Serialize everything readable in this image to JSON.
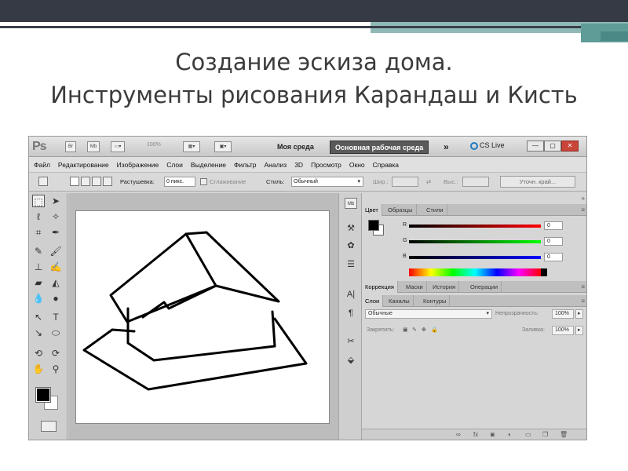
{
  "slide": {
    "title_line1": "Создание эскиза дома.",
    "title_line2": "Инструменты рисования Карандаш и Кисть"
  },
  "app": {
    "logo": "Ps",
    "appbar": {
      "zoom": "100%",
      "workspace_a": "Моя среда",
      "workspace_b": "Основная рабочая среда",
      "more": "»",
      "cslive": "CS Live"
    },
    "menu": [
      "Файл",
      "Редактирование",
      "Изображение",
      "Слои",
      "Выделение",
      "Фильтр",
      "Анализ",
      "3D",
      "Просмотр",
      "Окно",
      "Справка"
    ],
    "options": {
      "feather_label": "Растушевка:",
      "feather_value": "0 пикс.",
      "antialias_label": "Сглаживание",
      "style_label": "Стиль:",
      "style_value": "Обычный",
      "width_label": "Шир.:",
      "height_label": "Выс.:",
      "refine_edge": "Уточн. край..."
    },
    "color_panel": {
      "tabs": [
        "Цвет",
        "Образцы",
        "Стили"
      ],
      "channels": [
        {
          "label": "R",
          "value": "0",
          "color_from": "#000000",
          "color_to": "#ff0000"
        },
        {
          "label": "G",
          "value": "0",
          "color_from": "#000000",
          "color_to": "#00ff00"
        },
        {
          "label": "B",
          "value": "0",
          "color_from": "#000000",
          "color_to": "#0000ff"
        }
      ]
    },
    "adjust_panel": {
      "tabs": [
        "Коррекция",
        "Маски",
        "История",
        "Операции"
      ]
    },
    "layers_panel": {
      "tabs": [
        "Слои",
        "Каналы",
        "Контуры"
      ],
      "blend_mode": "Обычные",
      "opacity_label": "Непрозрачность:",
      "opacity_value": "100%",
      "lock_label": "Закрепить:",
      "fill_label": "Заливка:",
      "fill_value": "100%"
    }
  }
}
